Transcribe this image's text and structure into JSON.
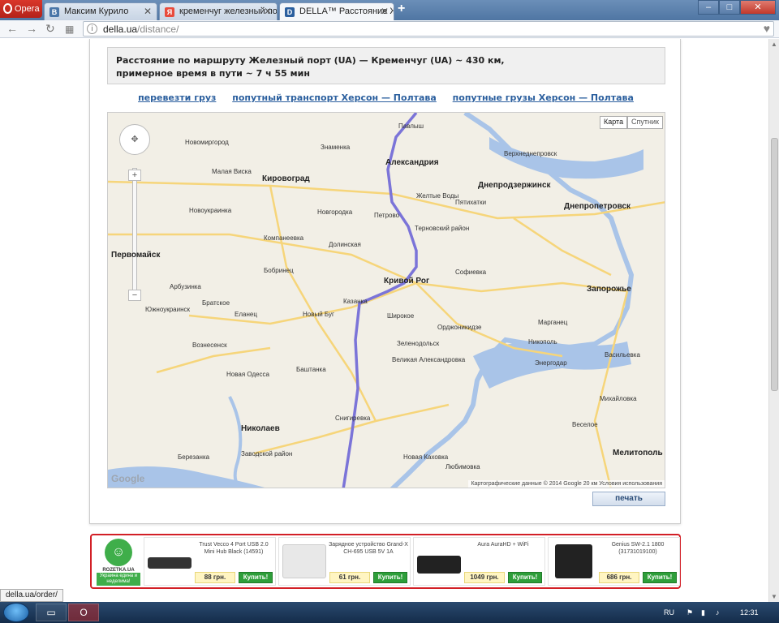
{
  "browser": {
    "menu_label": "Opera",
    "tabs": [
      {
        "favicon": "B",
        "favicon_color": "#4a76a8",
        "label": "Максим Курило",
        "close": "✕"
      },
      {
        "favicon": "Я",
        "favicon_color": "#e84b3c",
        "label": "кременчуг железный пор",
        "close": "✕"
      },
      {
        "favicon": "D",
        "favicon_color": "#2b5f9e",
        "label": "DELLA™ Расстояние Желе",
        "close": "✕"
      }
    ],
    "new_tab": "+",
    "url_host": "della.ua",
    "url_path": "/distance/"
  },
  "route": {
    "line1": "Расстояние по маршруту Железный порт (UA) — Кременчуг (UA) ~ 430 км,",
    "line2": "примерное время в пути ~ 7 ч 55 мин"
  },
  "links": [
    "перевезти груз",
    "попутный транспорт Херсон — Полтава",
    "попутные грузы Херсон — Полтава"
  ],
  "map": {
    "type_map": "Карта",
    "type_sat": "Спутник",
    "google": "Google",
    "copyright": "Картографические данные © 2014 Google   20 км   Условия использования",
    "route_color": "#7b74d8",
    "labels": [
      {
        "t": "Павлыш"
      },
      {
        "t": "Новомиргород"
      },
      {
        "t": "Знаменка"
      },
      {
        "t": "Александрия",
        "big": true
      },
      {
        "t": "Кировоград",
        "big": true
      },
      {
        "t": "Малая Виска"
      },
      {
        "t": "Верхнеднепровск"
      },
      {
        "t": "Днепродзержинск",
        "big": true
      },
      {
        "t": "Днепропетровск",
        "big": true
      },
      {
        "t": "Желтые Воды"
      },
      {
        "t": "Пятихатки"
      },
      {
        "t": "Петрово"
      },
      {
        "t": "Новоукраинка"
      },
      {
        "t": "Новгородка"
      },
      {
        "t": "Терновский район"
      },
      {
        "t": "Компанеевка"
      },
      {
        "t": "Долинская"
      },
      {
        "t": "Первомайск",
        "big": true
      },
      {
        "t": "Бобринец"
      },
      {
        "t": "Кривой Рог",
        "big": true
      },
      {
        "t": "Софиевка"
      },
      {
        "t": "Запорожье",
        "big": true
      },
      {
        "t": "Арбузинка"
      },
      {
        "t": "Казанка"
      },
      {
        "t": "Новый Буг"
      },
      {
        "t": "Широкое"
      },
      {
        "t": "Орджоникидзе"
      },
      {
        "t": "Марганец"
      },
      {
        "t": "Никополь"
      },
      {
        "t": "Южноукраинск"
      },
      {
        "t": "Братское"
      },
      {
        "t": "Еланец"
      },
      {
        "t": "Вознесенск"
      },
      {
        "t": "Зеленодольск"
      },
      {
        "t": "Энергодар"
      },
      {
        "t": "Васильевка"
      },
      {
        "t": "Великая Александровка"
      },
      {
        "t": "Новая Одесса"
      },
      {
        "t": "Баштанка"
      },
      {
        "t": "Снигиревка"
      },
      {
        "t": "Николаев",
        "big": true
      },
      {
        "t": "Михайловка"
      },
      {
        "t": "Заводской район"
      },
      {
        "t": "Новая Каховка"
      },
      {
        "t": "Любимовка"
      },
      {
        "t": "Мелитополь",
        "big": true
      },
      {
        "t": "Веселое"
      },
      {
        "t": "Березанка"
      }
    ]
  },
  "print_label": "печать",
  "ad": {
    "brand": "ROZETKA.UA",
    "tagline": "Украина едина и неделима!",
    "products": [
      {
        "name": "Trust Vecco 4 Port USB 2.0 Mini Hub Black (14591)",
        "price": "88 грн.",
        "buy": "Купить!"
      },
      {
        "name": "Зарядное устройство Grand-X CH-695 USB 5V 1A",
        "price": "61 грн.",
        "buy": "Купить!"
      },
      {
        "name": "Aura AuraHD + WiFi",
        "price": "1049 грн.",
        "buy": "Купить!"
      },
      {
        "name": "Genius SW-2.1 1800 (31731019100)",
        "price": "686 грн.",
        "buy": "Купить!"
      }
    ]
  },
  "status_url": "della.ua/order/",
  "taskbar": {
    "lang": "RU",
    "time": "12:31"
  }
}
